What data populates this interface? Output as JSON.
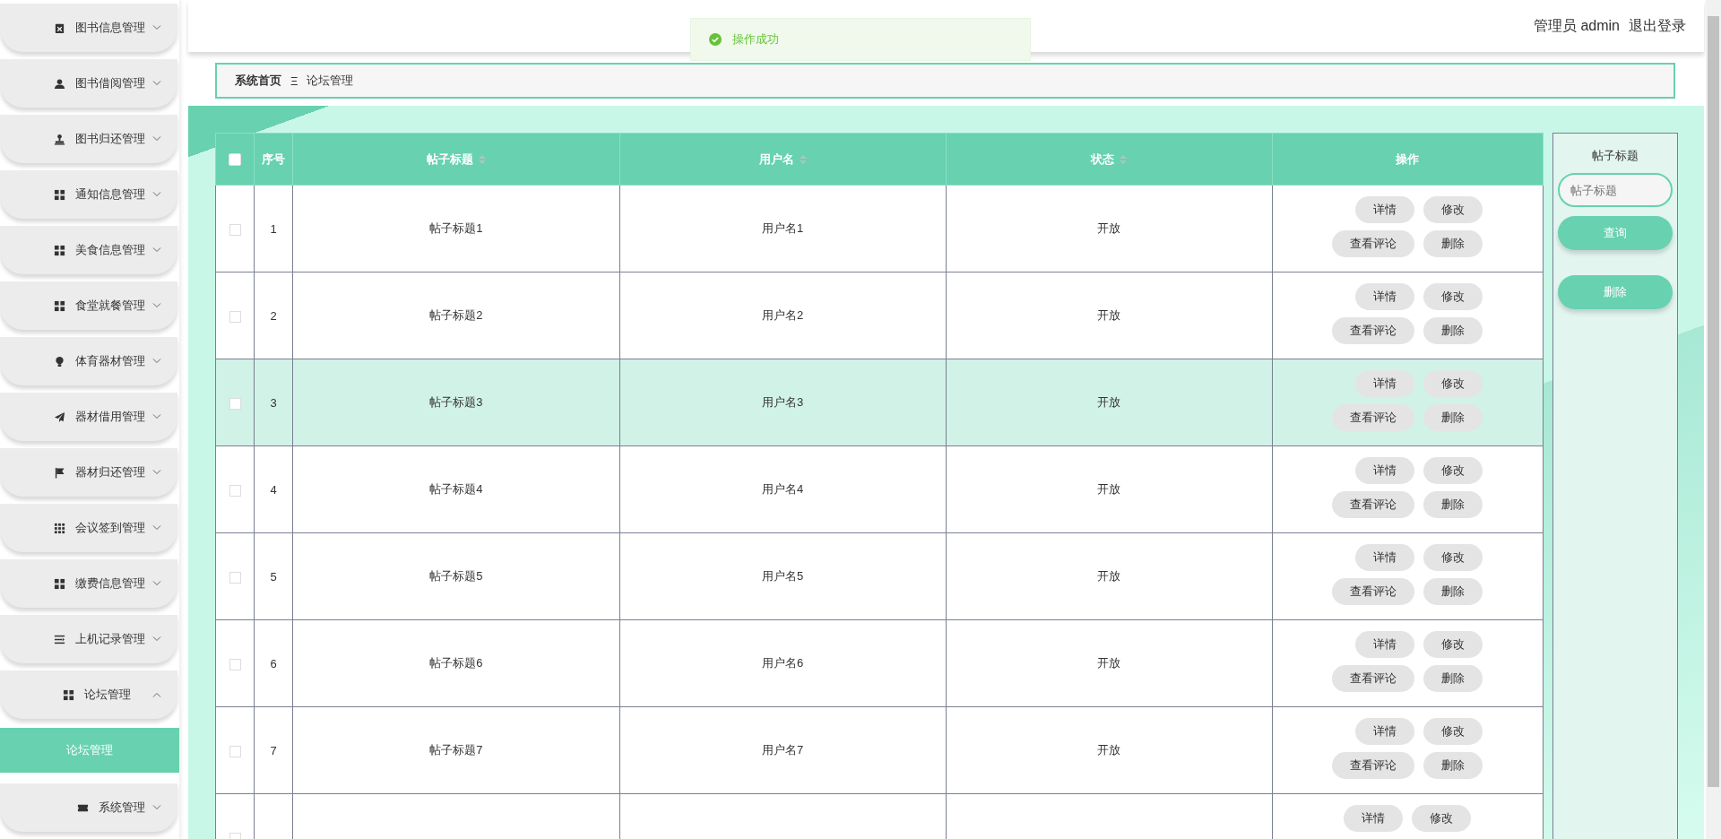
{
  "sidebar": {
    "items": [
      {
        "label": "图书信息管理",
        "kind": "clipboard",
        "expanded": false
      },
      {
        "label": "图书借阅管理",
        "kind": "user",
        "expanded": false
      },
      {
        "label": "图书归还管理",
        "kind": "stamp",
        "expanded": false
      },
      {
        "label": "通知信息管理",
        "kind": "grid",
        "expanded": false
      },
      {
        "label": "美食信息管理",
        "kind": "grid",
        "expanded": false
      },
      {
        "label": "食堂就餐管理",
        "kind": "grid",
        "expanded": false
      },
      {
        "label": "体育器材管理",
        "kind": "bulb",
        "expanded": false
      },
      {
        "label": "器材借用管理",
        "kind": "plane",
        "expanded": false
      },
      {
        "label": "器材归还管理",
        "kind": "flag",
        "expanded": false
      },
      {
        "label": "会议签到管理",
        "kind": "grid9",
        "expanded": false
      },
      {
        "label": "缴费信息管理",
        "kind": "grid",
        "expanded": false
      },
      {
        "label": "上机记录管理",
        "kind": "lines",
        "expanded": false
      },
      {
        "label": "论坛管理",
        "kind": "grid",
        "expanded": true,
        "children": [
          {
            "label": "论坛管理",
            "selected": true
          }
        ]
      },
      {
        "label": "系统管理",
        "kind": "ticket",
        "expanded": false
      }
    ]
  },
  "header": {
    "user": "管理员 admin",
    "logout": "退出登录"
  },
  "toast": {
    "message": "操作成功"
  },
  "breadcrumb": {
    "home": "系统首页",
    "separator": "Ξ",
    "current": "论坛管理"
  },
  "table": {
    "select_all_checked": false,
    "columns": [
      {
        "label": "序号",
        "sortable": false
      },
      {
        "label": "帖子标题",
        "sortable": true
      },
      {
        "label": "用户名",
        "sortable": true
      },
      {
        "label": "状态",
        "sortable": true
      },
      {
        "label": "操作",
        "sortable": false
      }
    ],
    "rows": [
      {
        "index": "1",
        "title": "帖子标题1",
        "user": "用户名1",
        "status": "开放",
        "highlighted": false,
        "checked": false,
        "actions": [
          "详情",
          "修改",
          "查看评论",
          "删除"
        ]
      },
      {
        "index": "2",
        "title": "帖子标题2",
        "user": "用户名2",
        "status": "开放",
        "highlighted": false,
        "checked": false,
        "actions": [
          "详情",
          "修改",
          "查看评论",
          "删除"
        ]
      },
      {
        "index": "3",
        "title": "帖子标题3",
        "user": "用户名3",
        "status": "开放",
        "highlighted": true,
        "checked": false,
        "actions": [
          "详情",
          "修改",
          "查看评论",
          "删除"
        ]
      },
      {
        "index": "4",
        "title": "帖子标题4",
        "user": "用户名4",
        "status": "开放",
        "highlighted": false,
        "checked": false,
        "actions": [
          "详情",
          "修改",
          "查看评论",
          "删除"
        ]
      },
      {
        "index": "5",
        "title": "帖子标题5",
        "user": "用户名5",
        "status": "开放",
        "highlighted": false,
        "checked": false,
        "actions": [
          "详情",
          "修改",
          "查看评论",
          "删除"
        ]
      },
      {
        "index": "6",
        "title": "帖子标题6",
        "user": "用户名6",
        "status": "开放",
        "highlighted": false,
        "checked": false,
        "actions": [
          "详情",
          "修改",
          "查看评论",
          "删除"
        ]
      },
      {
        "index": "7",
        "title": "帖子标题7",
        "user": "用户名7",
        "status": "开放",
        "highlighted": false,
        "checked": false,
        "actions": [
          "详情",
          "修改",
          "查看评论",
          "删除"
        ]
      },
      {
        "highlighted": false,
        "checked": false,
        "actions": [
          "详情",
          "修改"
        ]
      }
    ]
  },
  "search": {
    "label": "帖子标题",
    "placeholder": "帖子标题",
    "query_button": "查询",
    "delete_button": "删除"
  }
}
